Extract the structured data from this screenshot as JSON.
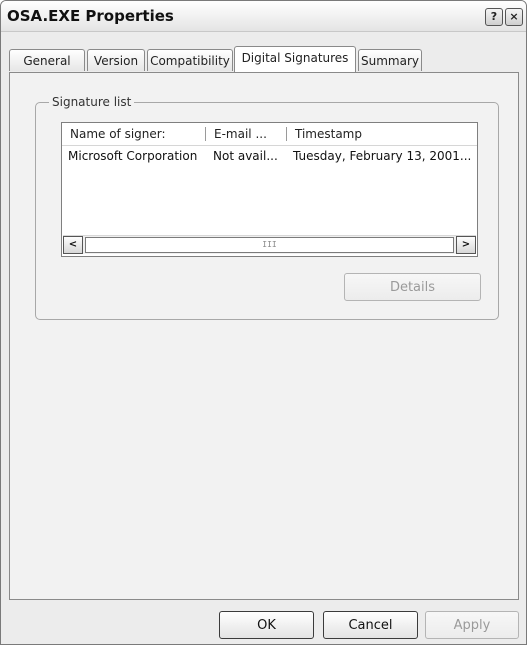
{
  "window": {
    "title": "OSA.EXE Properties",
    "help_button": "?",
    "close_button": "×"
  },
  "tabs": [
    {
      "label": "General",
      "active": false
    },
    {
      "label": "Version",
      "active": false
    },
    {
      "label": "Compatibility",
      "active": false
    },
    {
      "label": "Digital Signatures",
      "active": true
    },
    {
      "label": "Summary",
      "active": false
    }
  ],
  "signature_list": {
    "group_label": "Signature list",
    "columns": [
      "Name of signer:",
      "E-mail ...",
      "Timestamp"
    ],
    "rows": [
      {
        "name": "Microsoft Corporation",
        "email": "Not avail...",
        "timestamp": "Tuesday, February 13, 2001..."
      }
    ],
    "scroll_left": "<",
    "scroll_right": ">",
    "scroll_thumb_grip": "III"
  },
  "details_button": {
    "label": "Details",
    "enabled": false
  },
  "footer": {
    "ok_label": "OK",
    "cancel_label": "Cancel",
    "apply_label": "Apply",
    "apply_enabled": false
  }
}
